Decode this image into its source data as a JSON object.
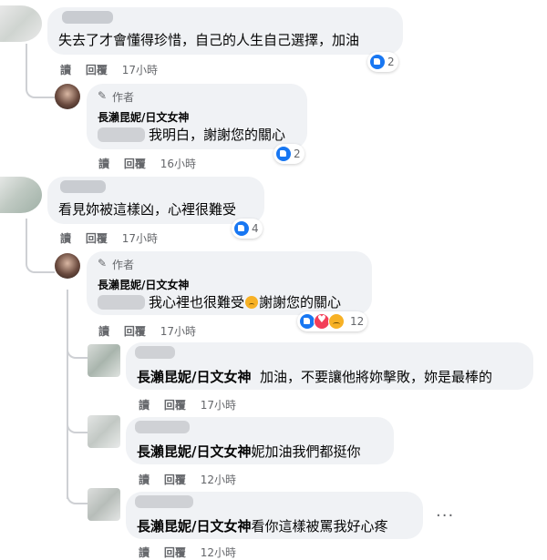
{
  "comments": [
    {
      "text": "失去了才會懂得珍惜，自己的人生自己選擇，加油",
      "actions": {
        "read": "讀",
        "reply": "回覆",
        "time": "17小時"
      },
      "reaction_count": "2"
    },
    {
      "author_badge": "作者",
      "name": "長瀨昆妮/日文女神",
      "text": "我明白，謝謝您的關心",
      "actions": {
        "read": "讀",
        "reply": "回覆",
        "time": "16小時"
      },
      "reaction_count": "2"
    },
    {
      "text": "看見妳被這樣凶，心裡很難受",
      "actions": {
        "read": "讀",
        "reply": "回覆",
        "time": "17小時"
      },
      "reaction_count": "4"
    },
    {
      "author_badge": "作者",
      "name": "長瀨昆妮/日文女神",
      "text_a": "我心裡也很難受",
      "text_b": "謝謝您的關心",
      "actions": {
        "read": "讀",
        "reply": "回覆",
        "time": "17小時"
      },
      "reaction_count": "12"
    },
    {
      "name": "長瀨昆妮/日文女神",
      "text": "加油，不要讓他將妳擊敗，妳是最棒的",
      "actions": {
        "read": "讀",
        "reply": "回覆",
        "time": "17小時"
      }
    },
    {
      "name": "長瀨昆妮/日文女神",
      "text": "妮加油我們都挺你",
      "actions": {
        "read": "讀",
        "reply": "回覆",
        "time": "12小時"
      }
    },
    {
      "name": "長瀨昆妮/日文女神",
      "text": "看你這樣被罵我好心疼",
      "actions": {
        "read": "讀",
        "reply": "回覆",
        "time": "12小時"
      },
      "more": "···"
    }
  ],
  "icons": {
    "like": "like-reaction-icon",
    "love": "love-reaction-icon",
    "sad": "sad-reaction-icon",
    "pencil": "pencil-icon"
  },
  "colors": {
    "bubble": "#f0f2f5",
    "like": "#1877f2",
    "love": "#f33e58",
    "sad": "#f7b125",
    "meta": "#65676b"
  }
}
